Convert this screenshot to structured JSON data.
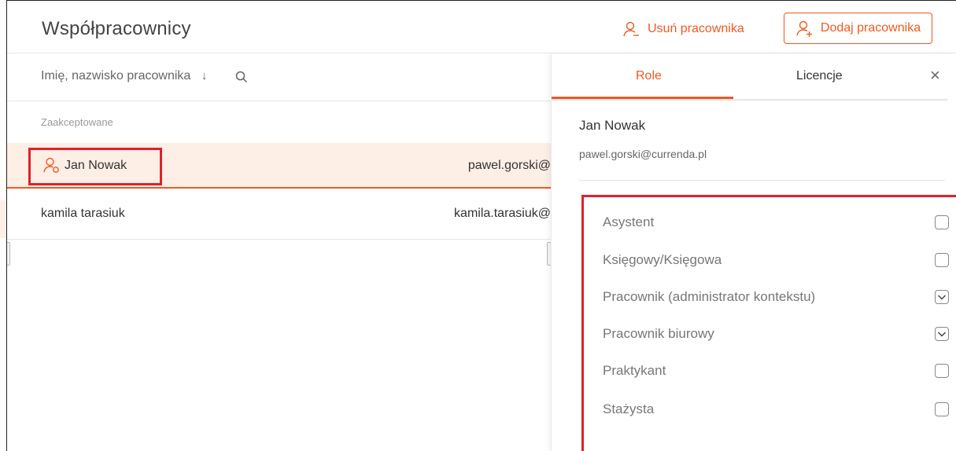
{
  "header": {
    "title": "Współpracownicy",
    "remove_label": "Usuń pracownika",
    "add_label": "Dodaj pracownika"
  },
  "list": {
    "sort_label": "Imię, nazwisko pracownika",
    "sort_arrow": "↓",
    "section_label": "Zaakceptowane",
    "rows": [
      {
        "name": "Jan Nowak",
        "email": "pawel.gorski@"
      },
      {
        "name": "kamila tarasiuk",
        "email": "kamila.tarasiuk@"
      }
    ]
  },
  "panel": {
    "tabs": [
      {
        "label": "Role",
        "active": true
      },
      {
        "label": "Licencje",
        "active": false
      }
    ],
    "close_label": "×",
    "person_name": "Jan Nowak",
    "person_email": "pawel.gorski@currenda.pl",
    "roles": [
      {
        "label": "Asystent",
        "checked": false
      },
      {
        "label": "Księgowy/Księgowa",
        "checked": false
      },
      {
        "label": "Pracownik (administrator kontekstu)",
        "checked": true
      },
      {
        "label": "Pracownik biurowy",
        "checked": true
      },
      {
        "label": "Praktykant",
        "checked": false
      },
      {
        "label": "Stażysta",
        "checked": false
      }
    ]
  },
  "colors": {
    "accent": "#ec5a24",
    "selected_row_bg": "#fdeee6",
    "highlight_border": "#e0202a"
  }
}
